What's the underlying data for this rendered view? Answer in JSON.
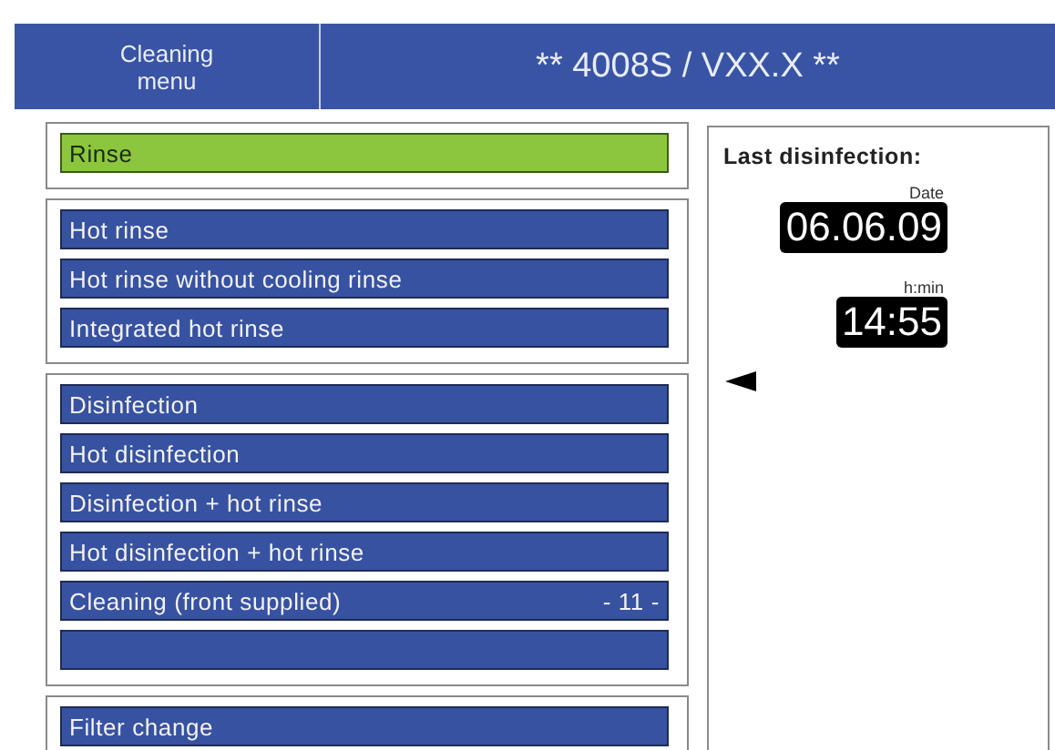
{
  "header": {
    "menu_title": "Cleaning\nmenu",
    "device": "** 4008S / VXX.X **"
  },
  "groups": [
    {
      "items": [
        {
          "label": "Rinse",
          "selected": true
        }
      ]
    },
    {
      "items": [
        {
          "label": "Hot rinse",
          "selected": false
        },
        {
          "label": "Hot rinse without cooling rinse",
          "selected": false
        },
        {
          "label": "Integrated hot rinse",
          "selected": false
        }
      ]
    },
    {
      "items": [
        {
          "label": "Disinfection",
          "selected": false
        },
        {
          "label": "Hot disinfection",
          "selected": false
        },
        {
          "label": "Disinfection + hot rinse",
          "selected": false
        },
        {
          "label": "Hot disinfection + hot rinse",
          "selected": false
        },
        {
          "label": "Cleaning (front supplied)",
          "value": "- 11 -",
          "selected": false
        },
        {
          "selected": false
        }
      ]
    },
    {
      "items": [
        {
          "label": "Filter change",
          "selected": false
        }
      ]
    }
  ],
  "last_disinfection": {
    "title": "Last disinfection:",
    "date_label": "Date",
    "date": "06.06.09",
    "time_label": "h:min",
    "time": "14:55"
  }
}
